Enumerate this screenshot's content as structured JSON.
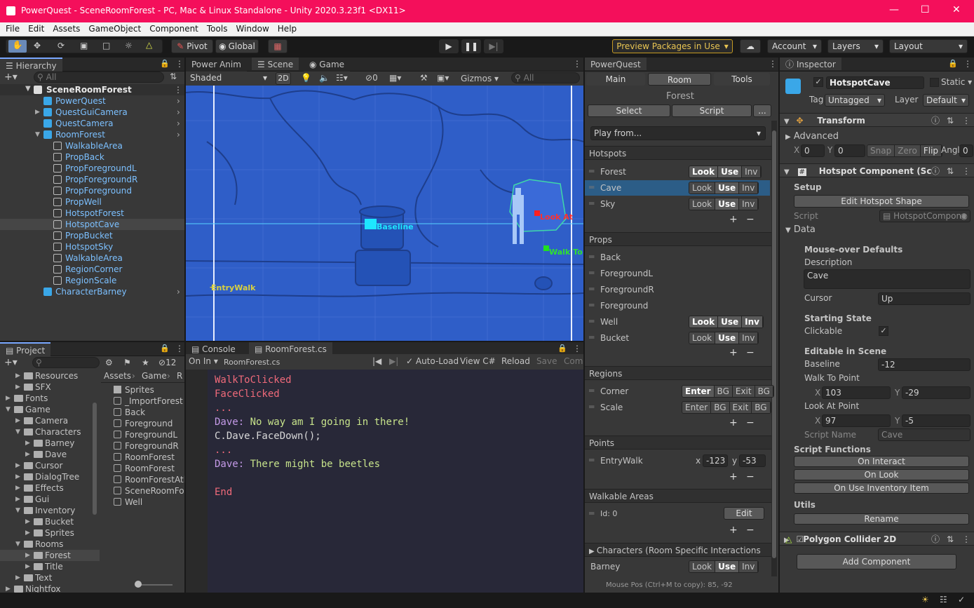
{
  "window": {
    "title": "PowerQuest - SceneRoomForest - PC, Mac & Linux Standalone - Unity 2020.3.23f1 <DX11>"
  },
  "menu": [
    "File",
    "Edit",
    "Assets",
    "GameObject",
    "Component",
    "Tools",
    "Window",
    "Help"
  ],
  "toolbar": {
    "pivot": "Pivot",
    "global": "Global",
    "preview": "Preview Packages in Use",
    "account": "Account",
    "layers": "Layers",
    "layout": "Layout"
  },
  "hierarchy": {
    "tab": "Hierarchy",
    "search": "All",
    "scene": "SceneRoomForest",
    "items": [
      {
        "t": "PowerQuest",
        "d": 1,
        "k": "c"
      },
      {
        "t": "QuestGuiCamera",
        "d": 1,
        "k": "c"
      },
      {
        "t": "QuestCamera",
        "d": 1,
        "k": "c"
      },
      {
        "t": "RoomForest",
        "d": 1,
        "k": "c"
      },
      {
        "t": "WalkableArea",
        "d": 2,
        "k": "o"
      },
      {
        "t": "PropBack",
        "d": 2,
        "k": "o"
      },
      {
        "t": "PropForegroundL",
        "d": 2,
        "k": "o"
      },
      {
        "t": "PropForegroundR",
        "d": 2,
        "k": "o"
      },
      {
        "t": "PropForeground",
        "d": 2,
        "k": "o"
      },
      {
        "t": "PropWell",
        "d": 2,
        "k": "o"
      },
      {
        "t": "HotspotForest",
        "d": 2,
        "k": "o"
      },
      {
        "t": "HotspotCave",
        "d": 2,
        "k": "o"
      },
      {
        "t": "PropBucket",
        "d": 2,
        "k": "o"
      },
      {
        "t": "HotspotSky",
        "d": 2,
        "k": "o"
      },
      {
        "t": "WalkableArea",
        "d": 2,
        "k": "o"
      },
      {
        "t": "RegionCorner",
        "d": 2,
        "k": "o"
      },
      {
        "t": "RegionScale",
        "d": 2,
        "k": "o"
      },
      {
        "t": "CharacterBarney",
        "d": 1,
        "k": "c"
      }
    ]
  },
  "scene": {
    "tabs": [
      "Power Anim",
      "Scene",
      "Game"
    ],
    "shading": "Shaded",
    "mode2d": "2D",
    "hidden_count": "0",
    "gizmos": "Gizmos",
    "search": "All",
    "labels": {
      "baseline": "Baseline",
      "lookat": "Look At",
      "walkto": "Walk To",
      "entry": "EntryWalk"
    }
  },
  "project": {
    "tab": "Project",
    "count": "12",
    "tree": [
      {
        "t": "Resources",
        "d": 2
      },
      {
        "t": "SFX",
        "d": 2
      },
      {
        "t": "Fonts",
        "d": 1
      },
      {
        "t": "Game",
        "d": 1
      },
      {
        "t": "Camera",
        "d": 2
      },
      {
        "t": "Characters",
        "d": 2
      },
      {
        "t": "Barney",
        "d": 3
      },
      {
        "t": "Dave",
        "d": 3
      },
      {
        "t": "Cursor",
        "d": 2
      },
      {
        "t": "DialogTree",
        "d": 2
      },
      {
        "t": "Effects",
        "d": 2
      },
      {
        "t": "Gui",
        "d": 2
      },
      {
        "t": "Inventory",
        "d": 2
      },
      {
        "t": "Bucket",
        "d": 3
      },
      {
        "t": "Sprites",
        "d": 3
      },
      {
        "t": "Rooms",
        "d": 2
      },
      {
        "t": "Forest",
        "d": 3
      },
      {
        "t": "Title",
        "d": 3
      },
      {
        "t": "Text",
        "d": 2
      },
      {
        "t": "Nightfox",
        "d": 1
      }
    ],
    "breadcrumb": [
      "Assets",
      "Game",
      "R"
    ],
    "files": [
      "Sprites",
      "_ImportForest",
      "Back",
      "Foreground",
      "ForegroundL",
      "ForegroundR",
      "RoomForest",
      "RoomForest",
      "RoomForestAtl",
      "SceneRoomFor",
      "Well"
    ]
  },
  "console": {
    "tabs": [
      "Console",
      "RoomForest.cs"
    ],
    "oninput": "On In",
    "file": "RoomForest.cs",
    "autoload": "Auto-Load",
    "viewcs": "View C#",
    "reload": "Reload",
    "save": "Save",
    "com": "Com",
    "lines": [
      {
        "t": "WalkToClicked",
        "c": "#f06a7a"
      },
      {
        "t": "FaceClicked",
        "c": "#f06a7a"
      },
      {
        "t": "...",
        "c": "#f06a7a"
      },
      {
        "t": "Dave: No way am I going in there!",
        "c": "#c7e38b",
        "p": "Dave: "
      },
      {
        "t": "C.Dave.FaceDown();",
        "c": "#d8d8d8"
      },
      {
        "t": "...",
        "c": "#f06a7a"
      },
      {
        "t": "Dave: There might be beetles",
        "c": "#c7e38b",
        "p": "Dave: "
      },
      {
        "t": "",
        "c": "#fff"
      },
      {
        "t": "End",
        "c": "#f06a7a"
      }
    ]
  },
  "pq": {
    "tab": "PowerQuest",
    "tabs": [
      "Main",
      "Room",
      "Tools"
    ],
    "room": "Forest",
    "select": "Select",
    "script": "Script",
    "more": "...",
    "playfrom": "Play from...",
    "hotspots_h": "Hotspots",
    "hotspots": [
      {
        "n": "Forest",
        "s": [
          "Look",
          "Use",
          "Inv"
        ],
        "on": [
          0,
          1
        ]
      },
      {
        "n": "Cave",
        "s": [
          "Look",
          "Use",
          "Inv"
        ],
        "on": [
          1
        ]
      },
      {
        "n": "Sky",
        "s": [
          "Look",
          "Use",
          "Inv"
        ],
        "on": [
          1
        ]
      }
    ],
    "props_h": "Props",
    "props": [
      {
        "n": "Back"
      },
      {
        "n": "ForegroundL"
      },
      {
        "n": "ForegroundR"
      },
      {
        "n": "Foreground"
      },
      {
        "n": "Well",
        "s": [
          "Look",
          "Use",
          "Inv"
        ],
        "on": [
          0,
          1,
          2
        ]
      },
      {
        "n": "Bucket",
        "s": [
          "Look",
          "Use",
          "Inv"
        ],
        "on": [
          1
        ]
      }
    ],
    "regions_h": "Regions",
    "regions": [
      {
        "n": "Corner",
        "s": [
          "Enter",
          "BG",
          "Exit",
          "BG"
        ],
        "on": [
          0
        ]
      },
      {
        "n": "Scale",
        "s": [
          "Enter",
          "BG",
          "Exit",
          "BG"
        ],
        "on": []
      }
    ],
    "points_h": "Points",
    "point": {
      "n": "EntryWalk",
      "xl": "x",
      "x": "-123",
      "yl": "y",
      "y": "-53"
    },
    "walk_h": "Walkable Areas",
    "walk": {
      "n": "Id: 0",
      "edit": "Edit"
    },
    "chars_h": "Characters (Room Specific Interactions",
    "char": {
      "n": "Barney",
      "s": [
        "Look",
        "Use",
        "Inv"
      ],
      "on": [
        1
      ]
    },
    "mouse": "Mouse Pos (Ctrl+M to copy): 85, -92"
  },
  "inspector": {
    "tab": "Inspector",
    "name": "HotspotCave",
    "static": "Static",
    "tag_l": "Tag",
    "tag": "Untagged",
    "layer_l": "Layer",
    "layer": "Default",
    "transform": "Transform",
    "advanced": "Advanced",
    "x_l": "X",
    "x": "0",
    "y_l": "Y",
    "y": "0",
    "snap": "Snap",
    "zero": "Zero",
    "flip": "Flip",
    "angle_l": "Angle",
    "angle": "0",
    "hc": "Hotspot Component (Sc",
    "setup": "Setup",
    "edit_shape": "Edit Hotspot Shape",
    "script_l": "Script",
    "script": "HotspotCompone",
    "data": "Data",
    "mouse_def": "Mouse-over Defaults",
    "desc_l": "Description",
    "desc": "Cave",
    "cursor_l": "Cursor",
    "cursor": "Up",
    "start": "Starting State",
    "clickable": "Clickable",
    "editable": "Editable in Scene",
    "baseline_l": "Baseline",
    "baseline": "-12",
    "walkto_l": "Walk To Point",
    "wx": "103",
    "wy": "-29",
    "lookat_l": "Look At Point",
    "lx": "97",
    "ly": "-5",
    "sname_l": "Script Name",
    "sname": "Cave",
    "sf": "Script Functions",
    "oninteract": "On Interact",
    "onlook": "On Look",
    "onuse": "On Use Inventory Item",
    "utils": "Utils",
    "rename": "Rename",
    "poly": "Polygon Collider 2D",
    "add": "Add Component"
  }
}
